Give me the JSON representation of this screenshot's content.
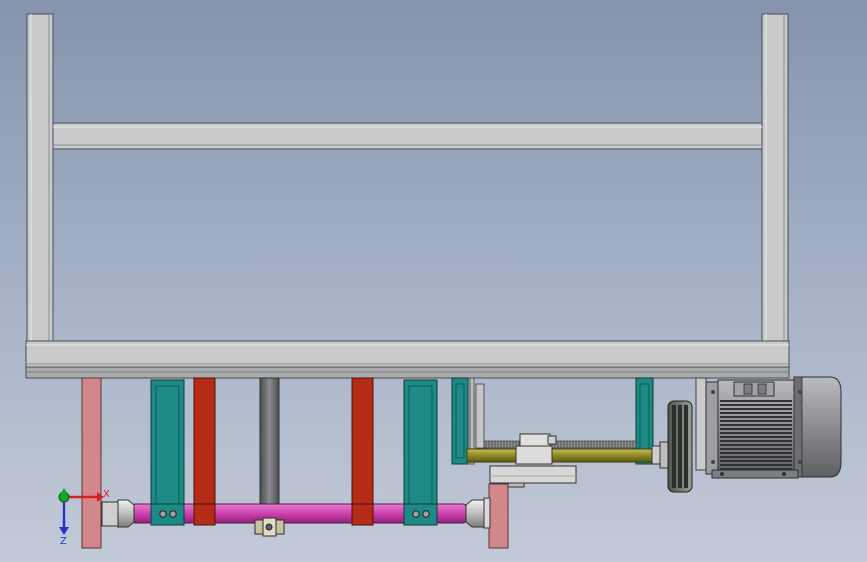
{
  "viewport": {
    "background_top": "#8593ad",
    "background_bottom": "#c3cad8"
  },
  "axis_triad": {
    "x_label": "X",
    "z_label": "Z",
    "x_color": "#d42020",
    "y_color": "#16a82a",
    "z_color": "#2733d0"
  },
  "colors": {
    "frame": "#c8cacb",
    "frame_edge": "#4a4c50",
    "pink_leg": "#d2888b",
    "teal_bracket": "#1d8a86",
    "red_bar": "#b42b16",
    "grey_rod": "#6c6e72",
    "magenta_shaft": "#cf40b0",
    "olive_screw": "#8f8a24",
    "motor_body": "#8a8c8f",
    "motor_dark": "#3d3f42"
  }
}
